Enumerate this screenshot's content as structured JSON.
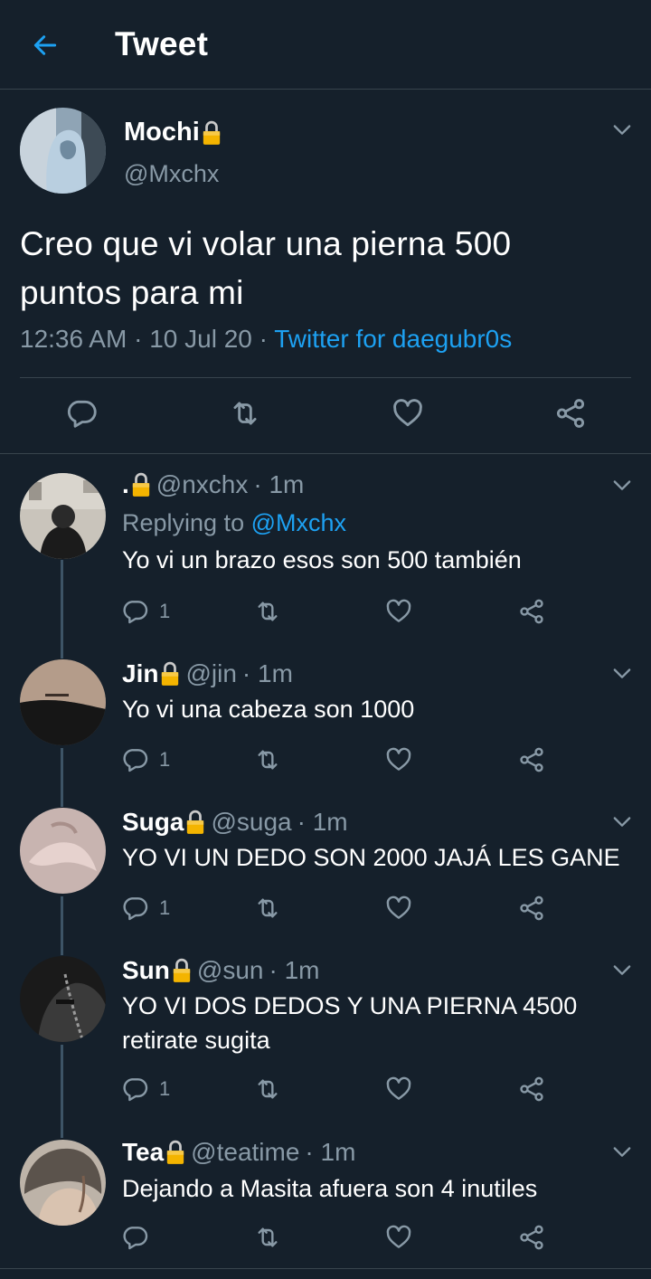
{
  "header": {
    "title": "Tweet"
  },
  "colors": {
    "background": "#15202b",
    "accent": "#1da1f2",
    "muted": "#8899a6",
    "divider": "#38444d"
  },
  "main_tweet": {
    "name": "Mochi",
    "handle": "@Mxchx",
    "text_line1": "Creo que vi volar una pierna 500",
    "text_line2": "puntos para mi",
    "time": "12:36 AM",
    "sep1": " · ",
    "date": "10 Jul 20",
    "sep2": " · ",
    "source": "Twitter for daegubr0s",
    "icons": [
      "reply-icon",
      "retweet-icon",
      "like-icon",
      "share-icon"
    ]
  },
  "replies": [
    {
      "name": ".",
      "handle": "@nxchx",
      "time": "· 1m",
      "replying_prefix": "Replying to ",
      "replying_to": "@Mxchx",
      "text": "Yo vi un brazo esos son 500 también",
      "reply_count": "1"
    },
    {
      "name": "Jin",
      "handle": "@jin",
      "time": "· 1m",
      "text": "Yo vi una cabeza son 1000",
      "reply_count": "1"
    },
    {
      "name": "Suga",
      "handle": "@suga",
      "time": "· 1m",
      "text": "YO VI UN DEDO SON 2000 JAJÁ LES GANE",
      "reply_count": "1"
    },
    {
      "name": "Sun",
      "handle": "@sun",
      "time": "· 1m",
      "text_line1": "YO VI DOS DEDOS Y UNA PIERNA 4500",
      "text_line2": "retirate sugita",
      "reply_count": "1"
    },
    {
      "name": "Tea",
      "handle": "@teatime",
      "time": "· 1m",
      "text": "Dejando a Masita afuera son 4 inutiles"
    }
  ]
}
